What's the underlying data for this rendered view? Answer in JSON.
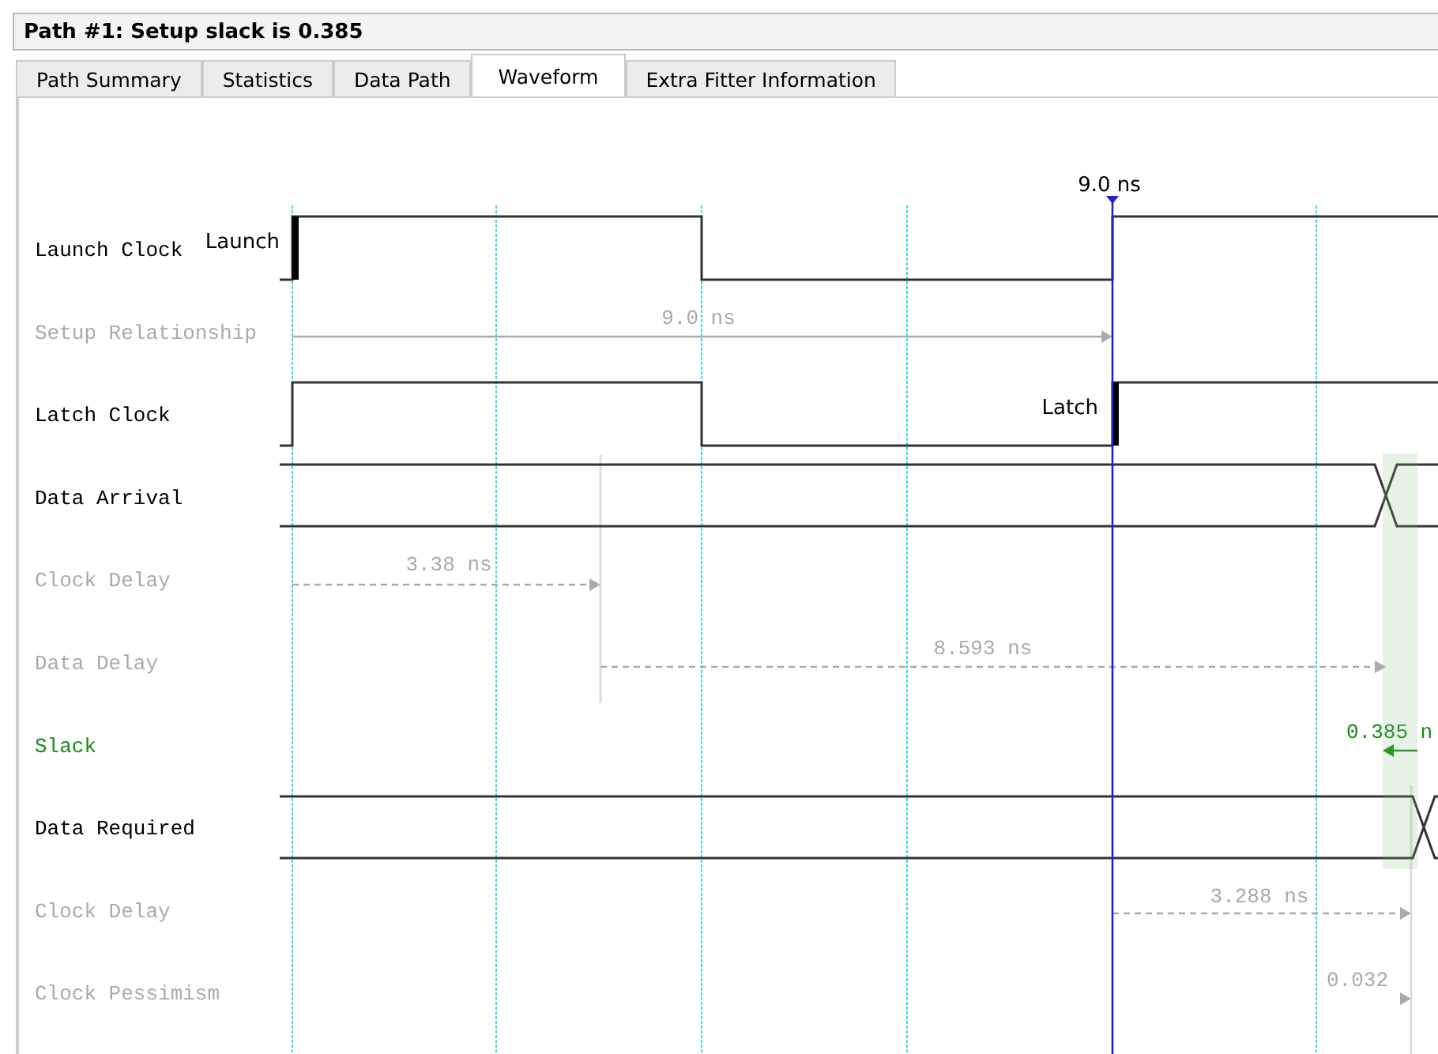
{
  "window": {
    "title": "Path #1: Setup slack is 0.385"
  },
  "tabs": [
    {
      "label": "Path Summary",
      "selected": false
    },
    {
      "label": "Statistics",
      "selected": false
    },
    {
      "label": "Data Path",
      "selected": false
    },
    {
      "label": "Waveform",
      "selected": true
    },
    {
      "label": "Extra Fitter Information",
      "selected": false
    }
  ],
  "waveform": {
    "cursor_label": "9.0 ns",
    "rows": [
      {
        "label": "Launch Clock",
        "kind": "clock",
        "edge_label": "Launch"
      },
      {
        "label": "Setup Relationship",
        "kind": "relationship",
        "value": "9.0 ns"
      },
      {
        "label": "Latch Clock",
        "kind": "clock",
        "edge_label": "Latch"
      },
      {
        "label": "Data Arrival",
        "kind": "bus"
      },
      {
        "label": "Clock Delay",
        "kind": "delay",
        "value": "3.38 ns"
      },
      {
        "label": "Data Delay",
        "kind": "delay",
        "value": "8.593 ns"
      },
      {
        "label": "Slack",
        "kind": "slack",
        "value": "0.385 n"
      },
      {
        "label": "Data Required",
        "kind": "bus"
      },
      {
        "label": "Clock Delay",
        "kind": "delay",
        "value": "3.288 ns"
      },
      {
        "label": "Clock Pessimism",
        "kind": "delay",
        "value": "0.032"
      }
    ]
  }
}
